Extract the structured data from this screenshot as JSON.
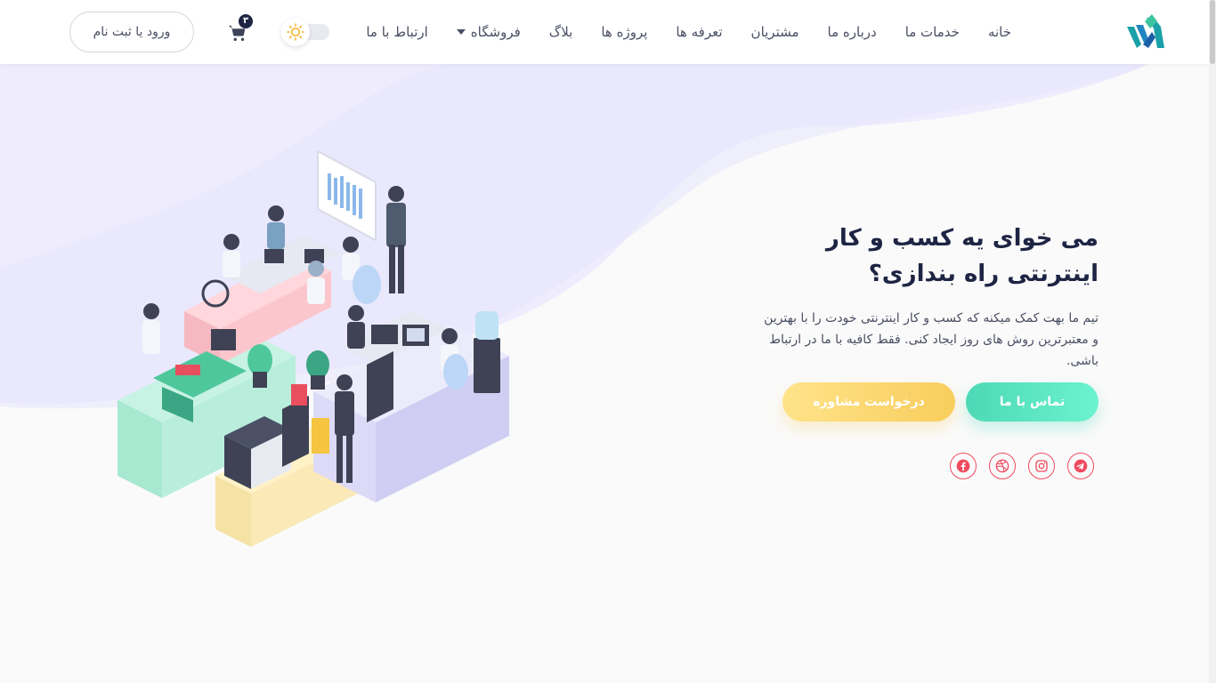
{
  "nav": {
    "items": [
      {
        "label": "خانه",
        "icon": ""
      },
      {
        "label": "خدمات ما",
        "icon": ""
      },
      {
        "label": "درباره ما",
        "icon": ""
      },
      {
        "label": "مشتریان",
        "icon": ""
      },
      {
        "label": "تعرفه ها",
        "icon": ""
      },
      {
        "label": "پروژه ها",
        "icon": ""
      },
      {
        "label": "بلاگ",
        "icon": ""
      },
      {
        "label": "فروشگاه",
        "icon": "caret-down-icon"
      },
      {
        "label": "ارتباط با ما",
        "icon": ""
      }
    ]
  },
  "header": {
    "cart_count": "۳",
    "login_label": "ورود یا ثبت نام",
    "theme_icon": "sun-icon"
  },
  "hero": {
    "title_line1": "می خوای یه کسب و کار",
    "title_line2": "اینترنتی راه بندازی؟",
    "description": "تیم ما بهت کمک میکنه که کسب و کار اینترنتی خودت را با بهترین و معتبرترین روش های روز ایجاد کنی. فقط کافیه با ما در ارتباط باشی.",
    "primary_button": "تماس با ما",
    "secondary_button": "درخواست مشاوره"
  },
  "socials": [
    {
      "icon": "telegram-icon"
    },
    {
      "icon": "instagram-icon"
    },
    {
      "icon": "dribbble-icon"
    },
    {
      "icon": "facebook-icon"
    }
  ],
  "colors": {
    "accent_green": "#4dd9b5",
    "accent_yellow": "#f8cd5c",
    "social_red": "#ef4a5e",
    "title": "#1e2443",
    "wave": "#eceaff"
  }
}
